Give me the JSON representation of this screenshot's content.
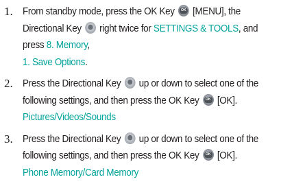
{
  "steps": [
    {
      "number": "1.",
      "seg_a": "From standby mode, press the OK Key ",
      "ok_key_icon": "ok-key-icon",
      "seg_b": " [MENU], the Directional Key ",
      "dir_key_icon": "directional-key-icon",
      "seg_c": " right twice for ",
      "menu_name": "SETTINGS & TOOLS",
      "seg_d": ", and press ",
      "submenu_name": "8. Memory",
      "seg_e": ", ",
      "option_name": "1. Save Options",
      "seg_f": "."
    },
    {
      "number": "2.",
      "seg_a": "Press the Directional Key ",
      "dir_key_icon": "directional-key-icon",
      "seg_b": " up or down to select one of the following settings, and then press the OK Key ",
      "ok_key_icon": "ok-key-icon",
      "seg_c": " [OK].",
      "choices": "Pictures/Videos/Sounds"
    },
    {
      "number": "3.",
      "seg_a": "Press the Directional Key ",
      "dir_key_icon": "directional-key-icon",
      "seg_b": " up or down to select one of the following settings, and then press the OK Key ",
      "ok_key_icon": "ok-key-icon",
      "seg_c": " [OK].",
      "choices": "Phone Memory/Card Memory"
    }
  ],
  "ok_key_text": "OK",
  "colors": {
    "text": "#231f20",
    "highlight": "#00a39a"
  }
}
